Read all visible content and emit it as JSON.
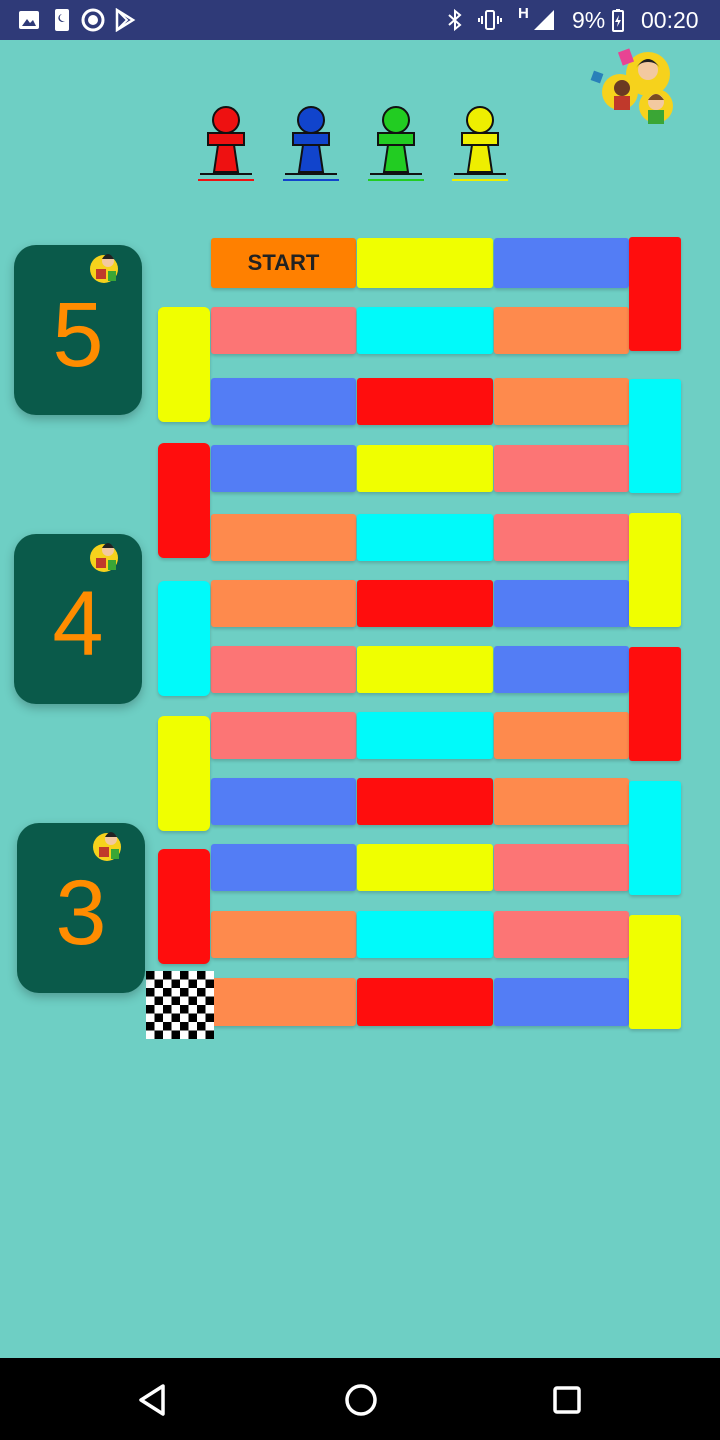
{
  "status_bar": {
    "battery": "9%",
    "time": "00:20",
    "network": "H"
  },
  "players": [
    {
      "color": "#ee1111",
      "icon": "red-pawn-icon"
    },
    {
      "color": "#1144cc",
      "icon": "blue-pawn-icon"
    },
    {
      "color": "#22cc22",
      "icon": "green-pawn-icon"
    },
    {
      "color": "#eeee00",
      "icon": "yellow-pawn-icon"
    }
  ],
  "cards": [
    {
      "value": "5"
    },
    {
      "value": "4"
    },
    {
      "value": "3"
    }
  ],
  "board": {
    "start_label": "START",
    "colors": {
      "yellow": "#f0ff00",
      "blue": "#537df5",
      "red": "#ff0d0d",
      "pink": "#fc7575",
      "cyan": "#00fafa",
      "orange": "#fe8a4d",
      "start": "#ff8000"
    },
    "rows": [
      [
        "start",
        "yellow",
        "blue"
      ],
      [
        "pink",
        "cyan",
        "orange"
      ],
      [
        "blue",
        "red",
        "orange"
      ],
      [
        "blue",
        "yellow",
        "pink"
      ],
      [
        "orange",
        "cyan",
        "pink"
      ],
      [
        "orange",
        "red",
        "blue"
      ],
      [
        "pink",
        "yellow",
        "blue"
      ],
      [
        "pink",
        "cyan",
        "orange"
      ],
      [
        "blue",
        "red",
        "orange"
      ],
      [
        "blue",
        "yellow",
        "pink"
      ],
      [
        "orange",
        "cyan",
        "pink"
      ],
      [
        "orange",
        "red",
        "blue"
      ]
    ],
    "right_column": [
      "red",
      "cyan",
      "yellow",
      "red",
      "cyan",
      "yellow"
    ],
    "left_column": [
      "yellow",
      "red",
      "cyan",
      "yellow",
      "red"
    ]
  },
  "nav": {
    "back": "back-icon",
    "home": "home-icon",
    "recents": "recents-icon"
  }
}
